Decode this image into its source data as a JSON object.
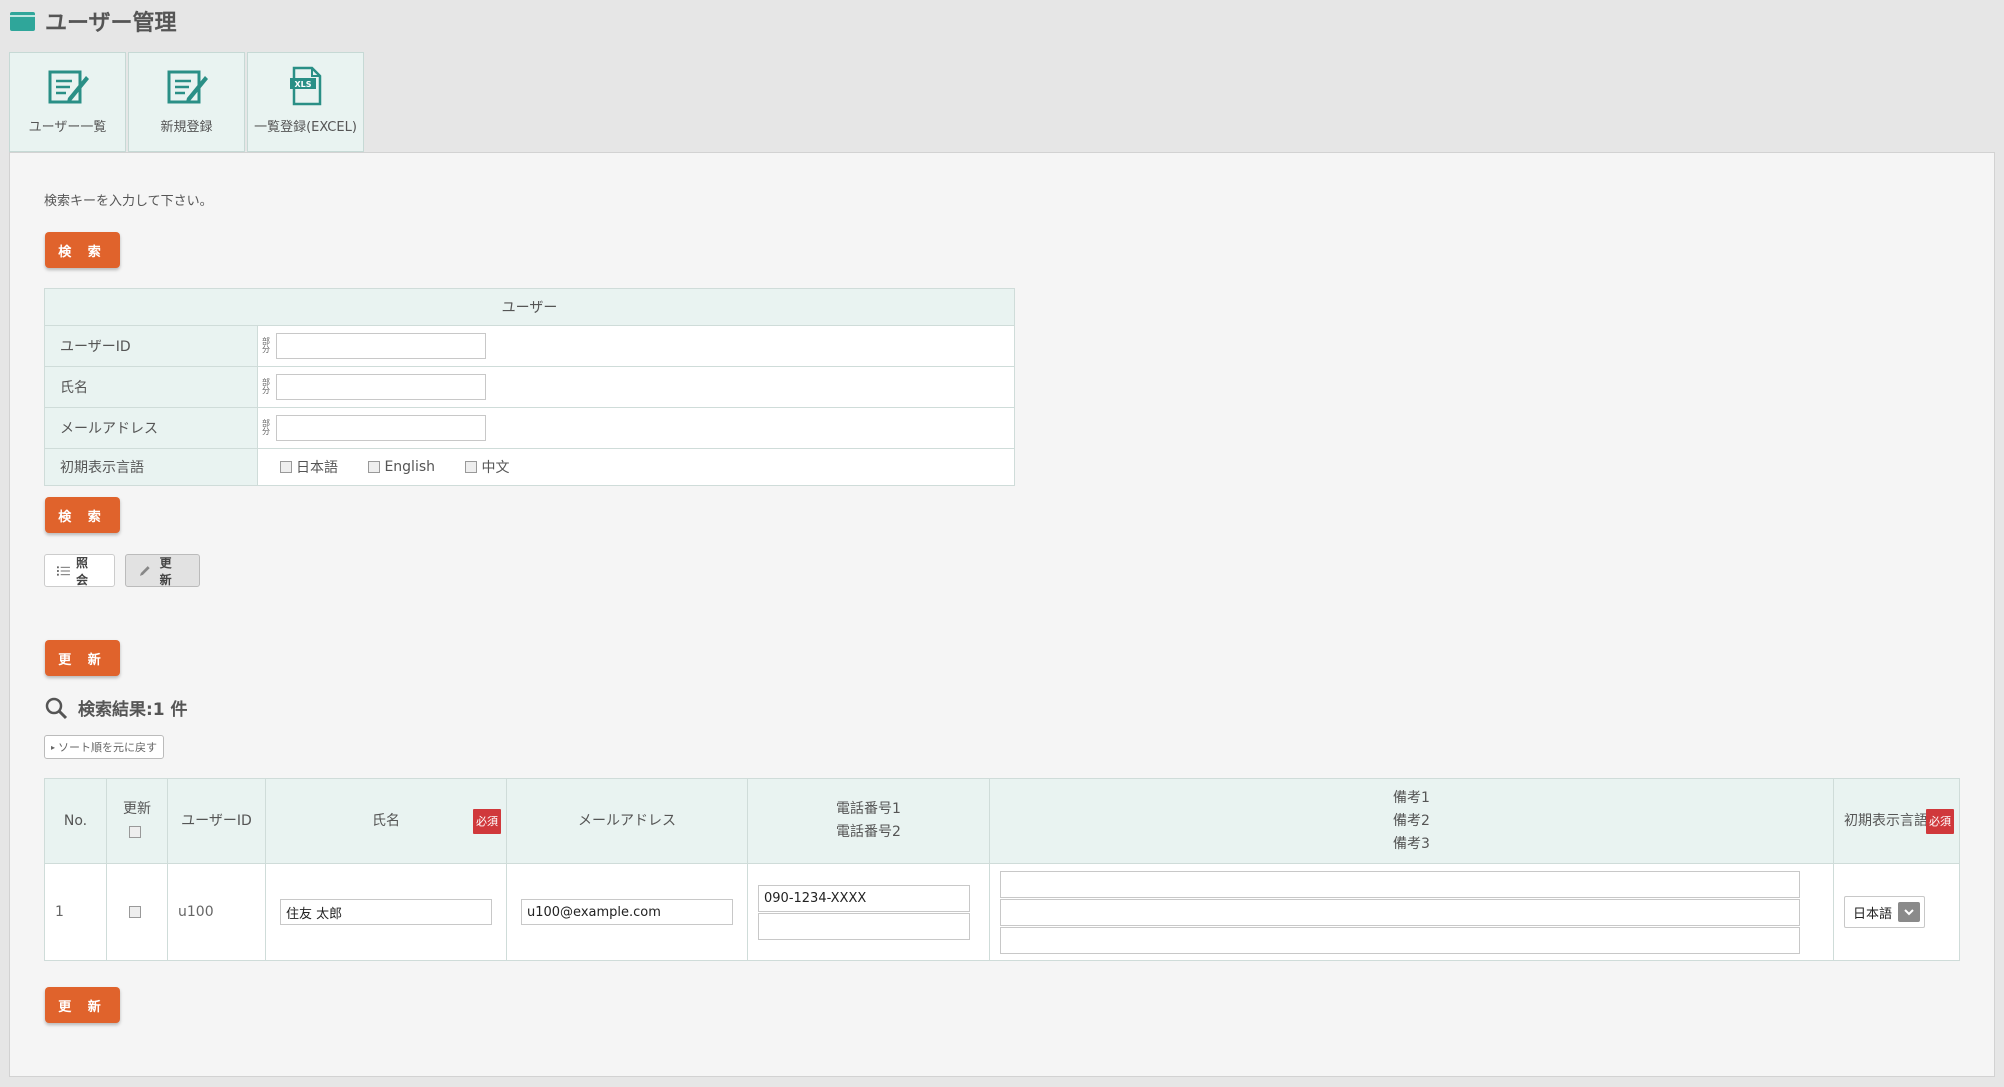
{
  "page": {
    "title": "ユーザー管理"
  },
  "tabs": [
    {
      "label": "ユーザー一覧",
      "icon": "edit-icon"
    },
    {
      "label": "新規登録",
      "icon": "edit-icon"
    },
    {
      "label": "一覧登録(EXCEL)",
      "icon": "xls-file-icon",
      "icon_text": "XLS"
    }
  ],
  "search": {
    "hint": "検索キーを入力して下さい。",
    "button_label": "検 索",
    "table_caption": "ユーザー",
    "part_mark": "部分",
    "fields": {
      "user_id": {
        "label": "ユーザーID",
        "value": ""
      },
      "name": {
        "label": "氏名",
        "value": ""
      },
      "email": {
        "label": "メールアドレス",
        "value": ""
      },
      "language": {
        "label": "初期表示言語",
        "options": [
          "日本語",
          "English",
          "中文"
        ]
      }
    }
  },
  "mode_buttons": {
    "view": "照 会",
    "edit": "更 新"
  },
  "update_button_label": "更 新",
  "results": {
    "title": "検索結果:1 件",
    "sort_reset": "ソート順を元に戻す",
    "required_badge": "必須",
    "columns": {
      "no": "No.",
      "update": "更新",
      "user_id": "ユーザーID",
      "name": "氏名",
      "email": "メールアドレス",
      "phone1": "電話番号1",
      "phone2": "電話番号2",
      "memo1": "備考1",
      "memo2": "備考2",
      "memo3": "備考3",
      "language": "初期表示言語"
    },
    "rows": [
      {
        "no": "1",
        "user_id": "u100",
        "name": "住友 太郎",
        "email": "u100@example.com",
        "phone1": "090-1234-XXXX",
        "phone2": "",
        "memo1": "",
        "memo2": "",
        "memo3": "",
        "language": "日本語"
      }
    ]
  },
  "colors": {
    "accent": "#e0632c",
    "title_icon": "#2fa69a",
    "header_bg": "#e9f3f1",
    "required": "#d0383b"
  }
}
